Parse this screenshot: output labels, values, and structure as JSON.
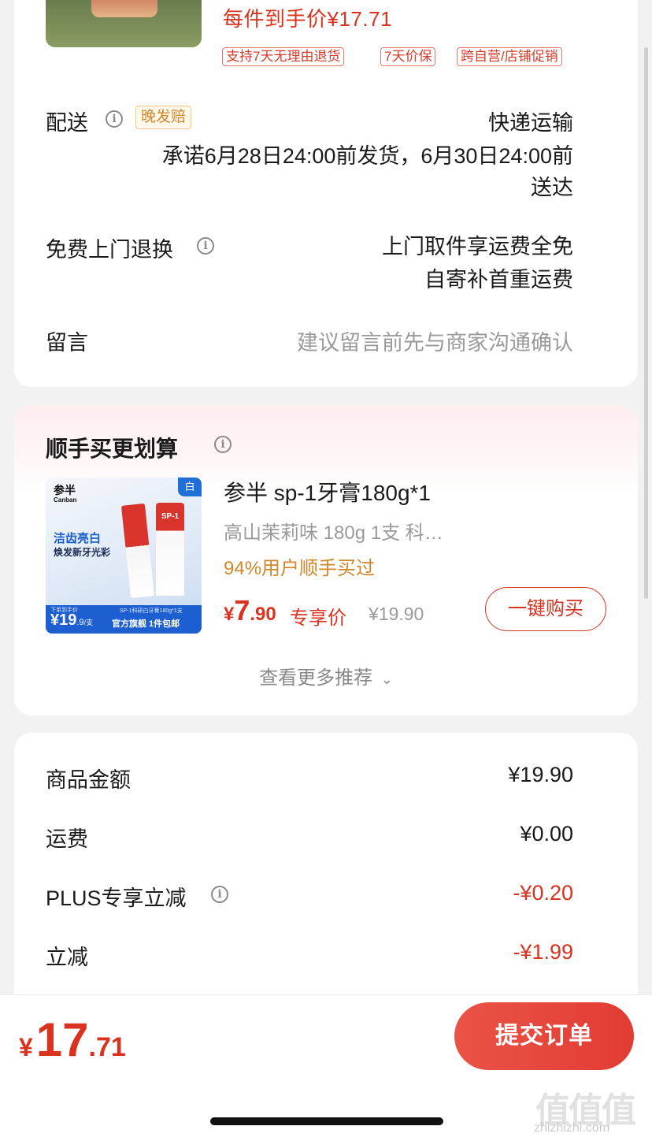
{
  "product_top": {
    "price_line": "每件到手价¥17.71",
    "tags": [
      "支持7天无理由退货",
      "7天价保",
      "跨自营/店铺促销"
    ]
  },
  "delivery": {
    "label": "配送",
    "badge": "晚发赔",
    "method": "快递运输",
    "promise_line1": "承诺6月28日24:00前发货，6月30日24:00前",
    "promise_line2": "送达"
  },
  "free_return": {
    "label": "免费上门退换",
    "line1": "上门取件享运费全免",
    "line2": "自寄补首重运费"
  },
  "message": {
    "label": "留言",
    "placeholder": "建议留言前先与商家沟通确认"
  },
  "addon": {
    "title": "顺手买更划算",
    "item": {
      "image_texts": {
        "brand_cn": "参半",
        "brand_en": "Canban",
        "corner": "白",
        "slogan1": "洁齿亮白",
        "slogan2": "焕发新牙光彩",
        "tube_label": "SP-1",
        "price_caption": "下单到手价",
        "price_main": "¥19",
        "price_decimal": ".9",
        "price_unit": "/支",
        "spec_caption": "SP-1科研白牙膏180g*1支",
        "footer": "官方旗舰 1件包邮"
      },
      "name": "参半 sp-1牙膏180g*1",
      "spec": "高山茉莉味 180g 1支 科…",
      "stat": "94%用户顺手买过",
      "currency": "¥",
      "price_int": "7",
      "price_dec": ".90",
      "price_label": "专享价",
      "original_price": "¥19.90",
      "buy_button": "一键购买"
    },
    "more": "查看更多推荐"
  },
  "summary": {
    "rows": [
      {
        "label": "商品金额",
        "value": "¥19.90"
      },
      {
        "label": "运费",
        "value": "¥0.00"
      },
      {
        "label": "PLUS专享立减",
        "value": "-¥0.20"
      },
      {
        "label": "立减",
        "value": "-¥1.99"
      }
    ]
  },
  "bottom_bar": {
    "currency": "¥",
    "total_int": "17",
    "total_dec": ".71",
    "submit": "提交订单"
  },
  "watermark": "zhizhizhi.com",
  "colors": {
    "accent_red": "#d9321f",
    "button_red": "#e8453c",
    "orange": "#d2862a"
  }
}
